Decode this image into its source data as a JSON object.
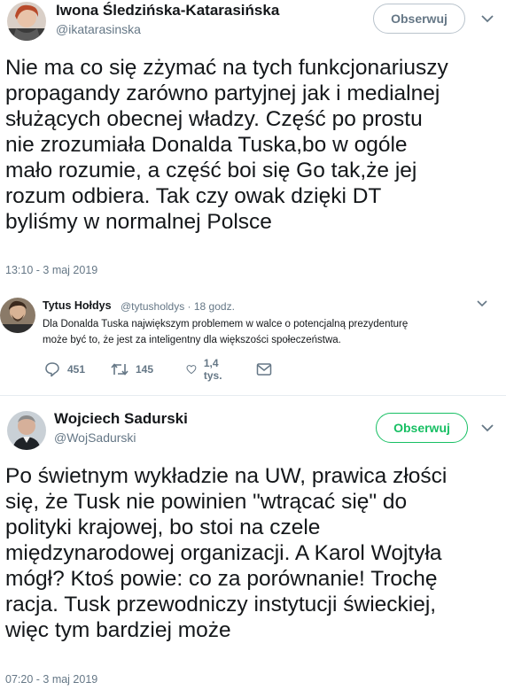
{
  "tweet1": {
    "name": "Iwona Śledzińska-Katarasińska",
    "handle": "@ikatarasinska",
    "follow_label": "Obserwuj",
    "body_lines": [
      "Nie ma co się zżymać na tych funkcjonariuszy",
      "propagandy zarówno partyjnej jak i medialnej",
      "służących obecnej władzy. Część po prostu",
      "nie zrozumiała Donalda Tuska,bo w ogóle",
      "mało rozumie, a część boi się Go tak,że jej",
      "rozum odbiera. Tak czy owak dzięki DT",
      "byliśmy w normalnej Polsce"
    ],
    "timestamp": "13:10 - 3 maj 2019"
  },
  "quoted": {
    "name": "Tytus Hołdys",
    "handle_time": "@tytusholdys · 18 godz.",
    "text_lines": [
      "Dla Donalda Tuska największym problemem w walce o potencjalną prezydenturę",
      "może być to, że jest za inteligentny dla większości społeczeństwa."
    ],
    "replies": "451",
    "retweets": "145",
    "likes": "1,4 tys."
  },
  "tweet2": {
    "name": "Wojciech Sadurski",
    "handle": "@WojSadurski",
    "follow_label": "Obserwuj",
    "body_lines": [
      "Po świetnym wykładzie na UW, prawica złości",
      "się, że Tusk nie powinien \"wtrącać się\" do",
      "polityki krajowej, bo stoi na czele",
      "międzynarodowej organizacji. A Karol Wojtyła",
      "mógł? Ktoś powie: co za porównanie! Trochę",
      "racja. Tusk przewodniczy instytucji świeckiej,",
      "więc tym bardziej może"
    ],
    "timestamp": "07:20 - 3 maj 2019"
  },
  "colors": {
    "text": "#14171a",
    "muted": "#657786",
    "follow_border_1": "#b9c3cc",
    "follow_green": "#17bf63"
  },
  "icons": [
    "reply-icon",
    "retweet-icon",
    "like-icon",
    "dm-icon",
    "chevron-down-icon"
  ]
}
